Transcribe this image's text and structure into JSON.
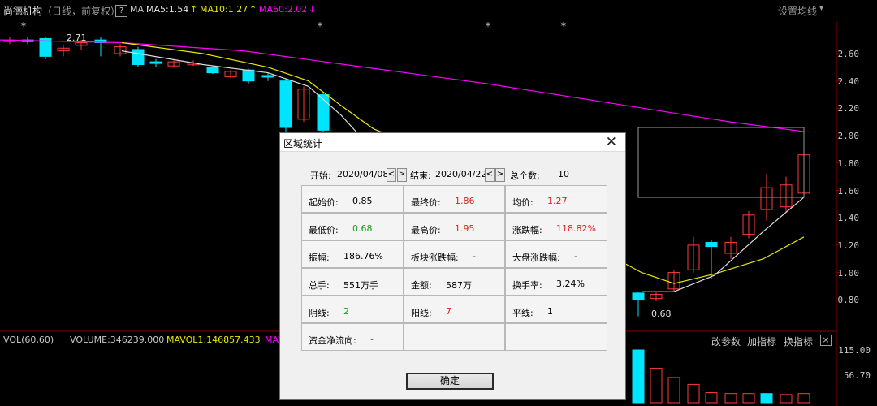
{
  "header": {
    "stock_name": "尚德机构",
    "period": "（日线，前复权）",
    "help": "?",
    "ma_label": "MA",
    "ma5": "MA5:1.54",
    "ma10": "MA10:1.27",
    "ma60": "MA60:2.02",
    "settings": "设置均线",
    "settings_arrow": "▾",
    "up_arrow": "↑",
    "down_arrow": "↓"
  },
  "price_axis": [
    "2.60",
    "2.40",
    "2.20",
    "2.00",
    "1.80",
    "1.60",
    "1.40",
    "1.20",
    "1.00",
    "0.80"
  ],
  "annotations": {
    "high": "2.71",
    "low": "0.68"
  },
  "volume": {
    "label": "VOL(60,60)",
    "value": "VOLUME:346239.000",
    "mavol1": "MAVOL1:146857.433",
    "mav_cut": "MAV",
    "links": [
      "改参数",
      "加指标",
      "换指标"
    ],
    "close": "×",
    "axis": [
      "115.00",
      "56.70"
    ]
  },
  "dialog": {
    "title": "区域统计",
    "close": "✕",
    "start_label": "开始:",
    "start_date": "2020/04/08",
    "end_label": "结束:",
    "end_date": "2020/04/22",
    "count_label": "总个数:",
    "count": "10",
    "prev": "<",
    "next": ">",
    "cells": [
      [
        {
          "l": "起始价:",
          "v": "0.85",
          "c": "#000000"
        },
        {
          "l": "最终价:",
          "v": "1.86",
          "c": "#e02020"
        },
        {
          "l": "均价:",
          "v": "1.27",
          "c": "#e02020"
        }
      ],
      [
        {
          "l": "最低价:",
          "v": "0.68",
          "c": "#16a016"
        },
        {
          "l": "最高价:",
          "v": "1.95",
          "c": "#e02020"
        },
        {
          "l": "涨跌幅:",
          "v": "118.82%",
          "c": "#e02020"
        }
      ],
      [
        {
          "l": "振幅:",
          "v": "186.76%",
          "c": "#000000"
        },
        {
          "l": "板块涨跌幅:",
          "v": "-",
          "c": "#000000"
        },
        {
          "l": "大盘涨跌幅:",
          "v": "-",
          "c": "#000000"
        }
      ],
      [
        {
          "l": "总手:",
          "v": "551万手",
          "c": "#000000"
        },
        {
          "l": "金额:",
          "v": "587万",
          "c": "#000000"
        },
        {
          "l": "换手率:",
          "v": "3.24%",
          "c": "#000000"
        }
      ],
      [
        {
          "l": "阴线:",
          "v": "2",
          "c": "#16a016"
        },
        {
          "l": "阳线:",
          "v": "7",
          "c": "#e02020"
        },
        {
          "l": "平线:",
          "v": "1",
          "c": "#000000"
        }
      ],
      [
        {
          "l": "资金净流向:",
          "v": "-",
          "c": "#000000"
        },
        {
          "l": "",
          "v": "",
          "c": "#000000"
        },
        {
          "l": "",
          "v": "",
          "c": "#000000"
        }
      ]
    ],
    "ok": "确定"
  },
  "colors": {
    "up": "#ff3b3b",
    "down": "#00e5ff",
    "ma5": "#dcdcdc",
    "ma10": "#e6e600",
    "ma60": "#ff00ff"
  }
}
